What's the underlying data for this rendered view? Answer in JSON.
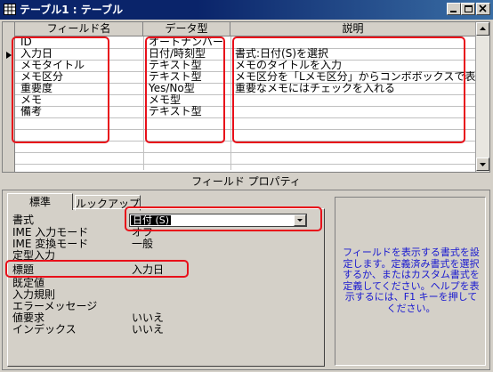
{
  "window": {
    "title": "テーブル1 : テーブル",
    "icon": "table-icon",
    "controls": [
      "minimize-icon",
      "maximize-icon",
      "close-icon"
    ]
  },
  "grid": {
    "headers": [
      "フィールド名",
      "データ型",
      "説明"
    ],
    "rows": [
      {
        "field": "ID",
        "type": "オートナンバー",
        "desc": ""
      },
      {
        "field": "入力日",
        "type": "日付/時刻型",
        "desc": "書式:日付(S)を選択"
      },
      {
        "field": "メモタイトル",
        "type": "テキスト型",
        "desc": "メモのタイトルを入力"
      },
      {
        "field": "メモ区分",
        "type": "テキスト型",
        "desc": "メモ区分を「Lメモ区分」からコンボボックスで表示"
      },
      {
        "field": "重要度",
        "type": "Yes/No型",
        "desc": "重要なメモにはチェックを入れる"
      },
      {
        "field": "メモ",
        "type": "メモ型",
        "desc": ""
      },
      {
        "field": "備考",
        "type": "テキスト型",
        "desc": ""
      }
    ],
    "current_row_indicator": "row-pointer-icon"
  },
  "properties": {
    "section_title": "フィールド プロパティ",
    "tabs": [
      "標準",
      "ルックアップ"
    ],
    "active_tab": "標準",
    "format": {
      "label": "書式",
      "value": "日付 (S)"
    },
    "rows": [
      {
        "label": "IME 入力モード",
        "value": "オフ"
      },
      {
        "label": "IME 変換モード",
        "value": "一般"
      },
      {
        "label": "定型入力",
        "value": ""
      },
      {
        "label": "標題",
        "value": "入力日"
      },
      {
        "label": "既定値",
        "value": ""
      },
      {
        "label": "入力規則",
        "value": ""
      },
      {
        "label": "エラーメッセージ",
        "value": ""
      },
      {
        "label": "値要求",
        "value": "いいえ"
      },
      {
        "label": "インデックス",
        "value": "いいえ"
      }
    ],
    "help_text": "フィールドを表示する書式を設定します。定義済み書式を選択するか、またはカスタム書式を定義してください。ヘルプを表示するには、F1 キーを押してください。"
  },
  "colors": {
    "highlight_box": "#e8101a",
    "help_text": "#1818d0",
    "title_bar": "#0a246a",
    "face": "#d4d0c8"
  }
}
